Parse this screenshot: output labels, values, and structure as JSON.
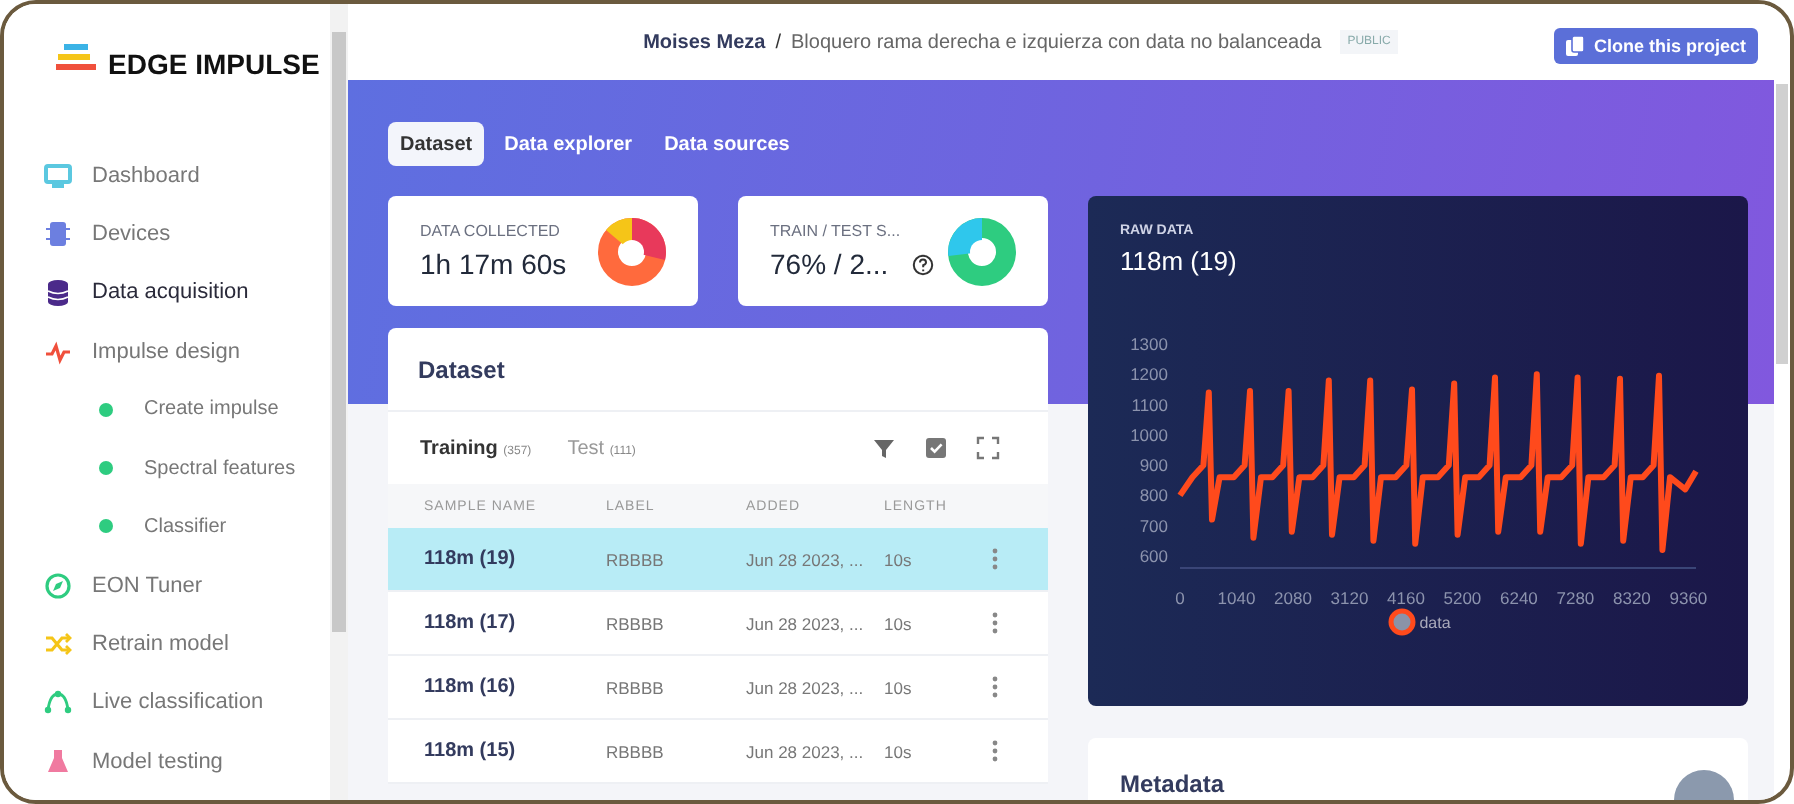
{
  "logo": {
    "text": "EDGE IMPULSE"
  },
  "sidebar": {
    "items": [
      {
        "label": "Dashboard",
        "kind": "monitor",
        "color": "#5bc8e0",
        "selected": false
      },
      {
        "label": "Devices",
        "kind": "chip",
        "color": "#6c7fe0",
        "selected": false
      },
      {
        "label": "Data acquisition",
        "kind": "database",
        "color": "#4b2a8a",
        "selected": true
      },
      {
        "label": "Impulse design",
        "kind": "pulse",
        "color": "#f0503c",
        "selected": false,
        "children": [
          {
            "label": "Create impulse",
            "kind": "dot",
            "color": "#2ecc80",
            "selected": false
          },
          {
            "label": "Spectral features",
            "kind": "dot",
            "color": "#2ecc80",
            "selected": false
          },
          {
            "label": "Classifier",
            "kind": "dot",
            "color": "#2ecc80",
            "selected": false
          }
        ]
      },
      {
        "label": "EON Tuner",
        "kind": "compass",
        "color": "#2ecc80",
        "selected": false
      },
      {
        "label": "Retrain model",
        "kind": "shuffle",
        "color": "#f5c518",
        "selected": false
      },
      {
        "label": "Live classification",
        "kind": "nodes",
        "color": "#2ecc80",
        "selected": false
      },
      {
        "label": "Model testing",
        "kind": "flask",
        "color": "#f07aa0",
        "selected": false
      }
    ]
  },
  "header": {
    "owner": "Moises Meza",
    "separator": "/",
    "project": "Bloquero rama derecha e izquierza con data no balanceada",
    "badge": "PUBLIC",
    "clone_button": "Clone this project"
  },
  "tabs": [
    {
      "label": "Dataset",
      "selected": true
    },
    {
      "label": "Data explorer",
      "selected": false
    },
    {
      "label": "Data sources",
      "selected": false
    }
  ],
  "stats": [
    {
      "title": "DATA COLLECTED",
      "value": "1h 17m 60s",
      "help": false,
      "kind": "collected"
    },
    {
      "title": "TRAIN / TEST S...",
      "value": "76% / 2...",
      "help": true,
      "kind": "split"
    }
  ],
  "dataset": {
    "title": "Dataset",
    "subtabs": [
      {
        "label": "Training",
        "count": "(357)",
        "selected": true
      },
      {
        "label": "Test",
        "count": "(111)",
        "selected": false
      }
    ],
    "columns": [
      "SAMPLE NAME",
      "LABEL",
      "ADDED",
      "LENGTH"
    ],
    "rows": [
      {
        "name": "118m (19)",
        "label": "RBBBB",
        "added": "Jun 28 2023, ...",
        "length": "10s",
        "selected": true
      },
      {
        "name": "118m (17)",
        "label": "RBBBB",
        "added": "Jun 28 2023, ...",
        "length": "10s",
        "selected": false
      },
      {
        "name": "118m (16)",
        "label": "RBBBB",
        "added": "Jun 28 2023, ...",
        "length": "10s",
        "selected": false
      },
      {
        "name": "118m (15)",
        "label": "RBBBB",
        "added": "Jun 28 2023, ...",
        "length": "10s",
        "selected": false
      }
    ]
  },
  "raw_data": {
    "caption": "RAW DATA",
    "title": "118m (19)",
    "chart_data": {
      "type": "line",
      "xlim": [
        0,
        9500
      ],
      "ylim": [
        600,
        1300
      ],
      "xticks": [
        0,
        1040,
        2080,
        3120,
        4160,
        5200,
        6240,
        7280,
        8320,
        9360
      ],
      "yticks": [
        600,
        700,
        800,
        900,
        1000,
        1100,
        1200,
        1300
      ],
      "x": [
        0,
        230,
        430,
        530,
        590,
        730,
        990,
        1190,
        1290,
        1350,
        1490,
        1700,
        1900,
        2000,
        2060,
        2200,
        2440,
        2640,
        2740,
        2800,
        2940,
        3200,
        3400,
        3500,
        3560,
        3700,
        3970,
        4170,
        4270,
        4330,
        4470,
        4750,
        4950,
        5050,
        5110,
        5250,
        5500,
        5700,
        5800,
        5860,
        6000,
        6270,
        6470,
        6570,
        6630,
        6770,
        7020,
        7220,
        7320,
        7380,
        7520,
        7800,
        8000,
        8100,
        8160,
        8300,
        8520,
        8720,
        8820,
        8880,
        9020,
        9300,
        9500
      ],
      "series": [
        {
          "name": "data",
          "color": "#ff4a1c",
          "values": [
            800,
            860,
            900,
            1140,
            720,
            860,
            860,
            900,
            1145,
            660,
            860,
            860,
            900,
            1145,
            680,
            860,
            860,
            900,
            1180,
            670,
            860,
            860,
            900,
            1180,
            650,
            860,
            860,
            900,
            1150,
            640,
            860,
            860,
            900,
            1170,
            670,
            860,
            860,
            900,
            1190,
            680,
            860,
            860,
            900,
            1200,
            680,
            860,
            860,
            900,
            1190,
            640,
            860,
            860,
            900,
            1185,
            650,
            860,
            860,
            900,
            1195,
            620,
            860,
            820,
            880
          ]
        }
      ]
    }
  },
  "metadata": {
    "title": "Metadata"
  }
}
